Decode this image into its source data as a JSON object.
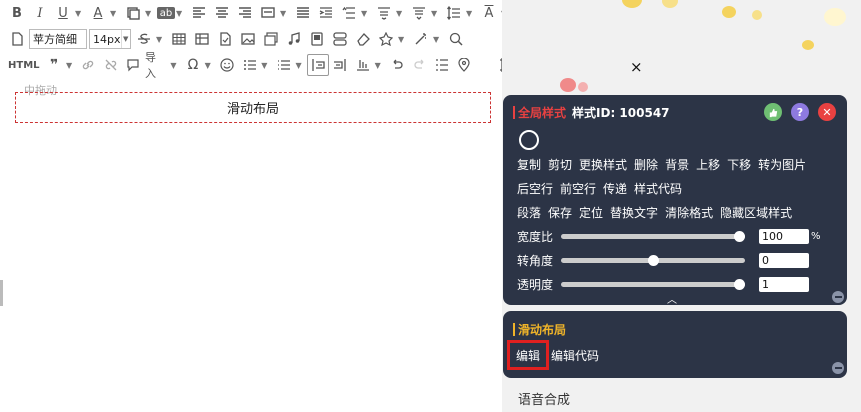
{
  "toolbar": {
    "row1": [
      "B",
      "I",
      "U",
      "A",
      "",
      "ab",
      "",
      "",
      "",
      "",
      "",
      "",
      "",
      "",
      "",
      "",
      "A"
    ],
    "font_family": "苹方简细",
    "font_size": "14px",
    "html_label": "HTML",
    "import_label": "导入"
  },
  "editor": {
    "drag_hint": "中拖动",
    "block_title": "滑动布局"
  },
  "panel_style": {
    "title_red": "全局样式",
    "title_id": "样式ID: 100547",
    "actions_row1": [
      "复制",
      "剪切",
      "更换样式",
      "删除",
      "背景",
      "上移",
      "下移",
      "转为图片"
    ],
    "actions_row2": [
      "后空行",
      "前空行",
      "传递",
      "样式代码"
    ],
    "actions_row3": [
      "段落",
      "保存",
      "定位",
      "替换文字",
      "清除格式",
      "隐藏区域样式"
    ],
    "sliders": [
      {
        "label": "宽度比",
        "value": "100",
        "unit": "%",
        "level": 1.0
      },
      {
        "label": "转角度",
        "value": "0",
        "unit": "",
        "level": 0.5
      },
      {
        "label": "透明度",
        "value": "1",
        "unit": "",
        "level": 1.0
      }
    ]
  },
  "panel_layout": {
    "title": "滑动布局",
    "edit_label": "编辑",
    "edit_code_label": "编辑代码"
  },
  "bottom_item": "语音合成",
  "close_glyph": "×",
  "colors": {
    "panel_bg": "#2c3446",
    "accent_red": "#e94141",
    "accent_yellow": "#f0b429",
    "highlight_box": "#e02020"
  }
}
